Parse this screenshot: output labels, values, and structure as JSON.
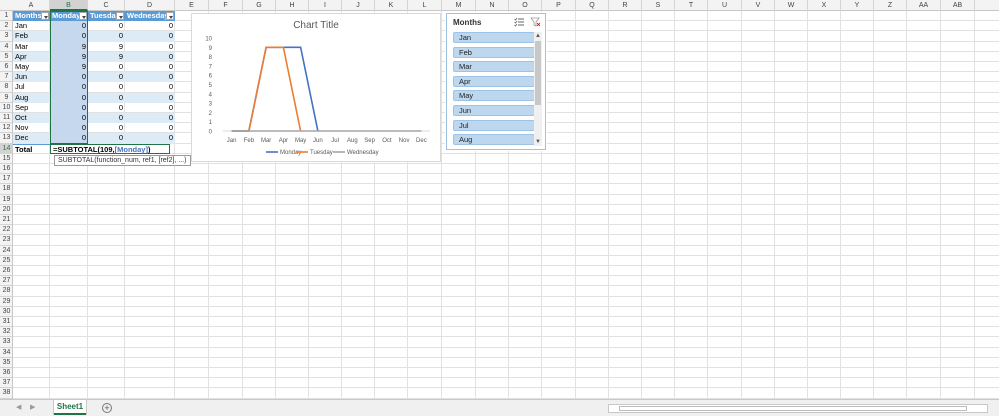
{
  "columns": [
    "A",
    "B",
    "C",
    "D",
    "E",
    "F",
    "G",
    "H",
    "I",
    "J",
    "K",
    "L",
    "M",
    "N",
    "O",
    "P",
    "Q",
    "R",
    "S",
    "T",
    "U",
    "V",
    "W",
    "X",
    "Y",
    "Z",
    "AA",
    "AB"
  ],
  "rows": [
    "1",
    "2",
    "3",
    "4",
    "5",
    "6",
    "7",
    "8",
    "9",
    "10",
    "11",
    "12",
    "13",
    "14",
    "15",
    "16",
    "17",
    "18",
    "19",
    "20",
    "21",
    "22",
    "23",
    "24",
    "25",
    "26",
    "27",
    "28",
    "29",
    "30",
    "31",
    "32",
    "33",
    "34",
    "35",
    "36",
    "37",
    "38"
  ],
  "table": {
    "headers": [
      "Months",
      "Monday",
      "Tuesday",
      "Wednesday"
    ],
    "rows": [
      [
        "Jan",
        "0",
        "0",
        "0"
      ],
      [
        "Feb",
        "0",
        "0",
        "0"
      ],
      [
        "Mar",
        "9",
        "9",
        "0"
      ],
      [
        "Apr",
        "9",
        "9",
        "0"
      ],
      [
        "May",
        "9",
        "0",
        "0"
      ],
      [
        "Jun",
        "0",
        "0",
        "0"
      ],
      [
        "Jul",
        "0",
        "0",
        "0"
      ],
      [
        "Aug",
        "0",
        "0",
        "0"
      ],
      [
        "Sep",
        "0",
        "0",
        "0"
      ],
      [
        "Oct",
        "0",
        "0",
        "0"
      ],
      [
        "Nov",
        "0",
        "0",
        "0"
      ],
      [
        "Dec",
        "0",
        "0",
        "0"
      ]
    ],
    "total_label": "Total",
    "formula": "=SUBTOTAL(109,[Monday])",
    "formula_hint": "SUBTOTAL(function_num, ref1, [ref2], ...)"
  },
  "chart_data": {
    "type": "line",
    "title": "Chart Title",
    "categories": [
      "Jan",
      "Feb",
      "Mar",
      "Apr",
      "May",
      "Jun",
      "Jul",
      "Aug",
      "Sep",
      "Oct",
      "Nov",
      "Dec"
    ],
    "series": [
      {
        "name": "Monday",
        "values": [
          0,
          0,
          9,
          9,
          9,
          0,
          null,
          null,
          null,
          null,
          null,
          null
        ],
        "color": "#4472c4"
      },
      {
        "name": "Tuesday",
        "values": [
          0,
          0,
          9,
          9,
          0,
          null,
          null,
          null,
          null,
          null,
          null,
          null
        ],
        "color": "#ed7d31"
      },
      {
        "name": "Wednesday",
        "values": [
          0,
          0,
          0,
          0,
          0,
          0,
          0,
          0,
          0,
          0,
          0,
          0
        ],
        "color": "#a5a5a5"
      }
    ],
    "ylim": [
      0,
      10
    ],
    "yticks": [
      "0",
      "1",
      "2",
      "3",
      "4",
      "5",
      "6",
      "7",
      "8",
      "9",
      "10"
    ],
    "legend": "bottom",
    "grid": false
  },
  "slicer": {
    "title": "Months",
    "items": [
      "Jan",
      "Feb",
      "Mar",
      "Apr",
      "May",
      "Jun",
      "Jul",
      "Aug"
    ],
    "multi_select_icon": "multi-select-icon",
    "clear_filter_icon": "clear-filter-icon"
  },
  "sheet_tab": "Sheet1",
  "add_sheet": "+",
  "accent_color": "#217346",
  "table_color": "#5b9bd5"
}
